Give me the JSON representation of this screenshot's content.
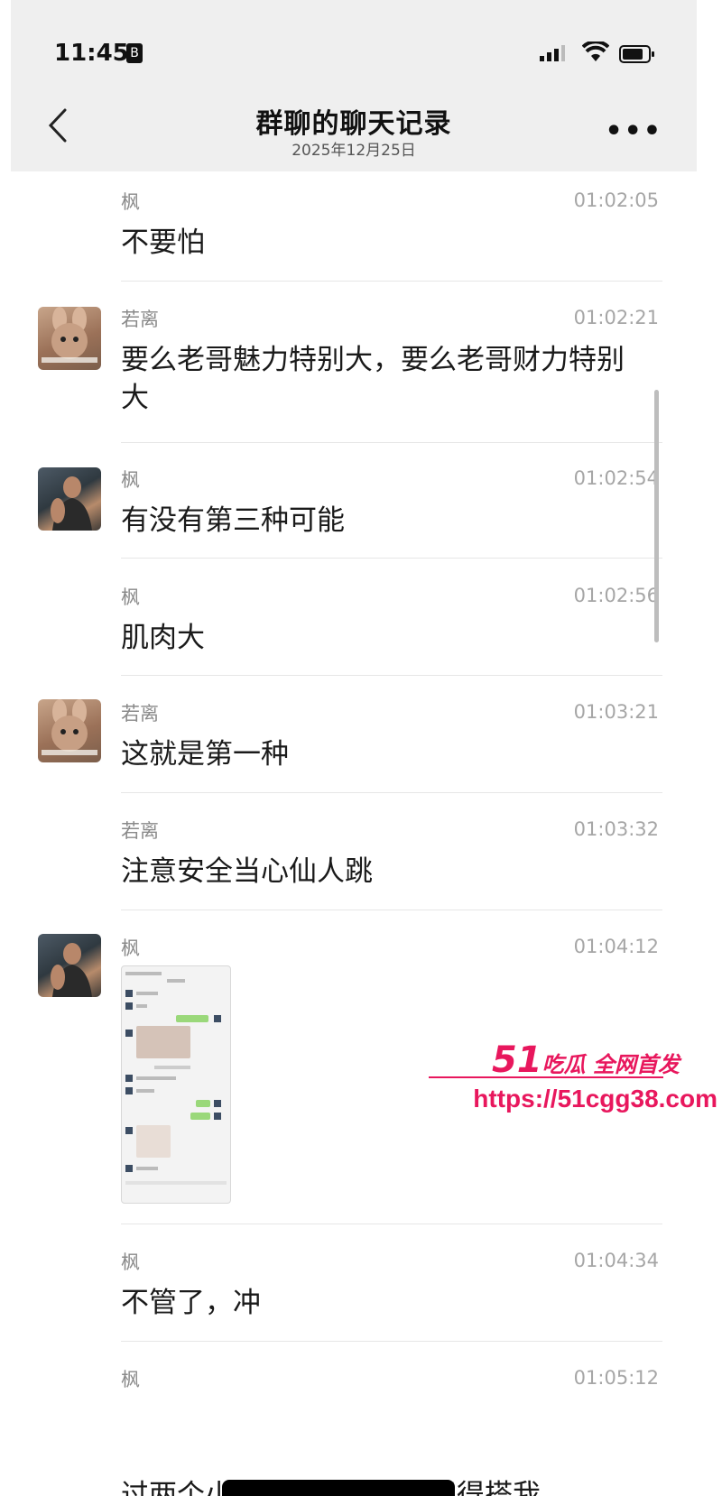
{
  "status_bar": {
    "time": "11:45",
    "badge": "B"
  },
  "header": {
    "title": "群聊的聊天记录",
    "subtitle": "2025年12月25日",
    "more": "•••"
  },
  "messages": [
    {
      "sender": "枫",
      "time": "01:02:05",
      "text": "不要怕"
    },
    {
      "sender": "若离",
      "time": "01:02:21",
      "text": "要么老哥魅力特别大，要么老哥财力特别大"
    },
    {
      "sender": "枫",
      "time": "01:02:54",
      "text": "有没有第三种可能"
    },
    {
      "sender": "枫",
      "time": "01:02:56",
      "text": "肌肉大"
    },
    {
      "sender": "若离",
      "time": "01:03:21",
      "text": "这就是第一种"
    },
    {
      "sender": "若离",
      "time": "01:03:32",
      "text": "注意安全当心仙人跳"
    },
    {
      "sender": "枫",
      "time": "01:04:12",
      "text": ""
    },
    {
      "sender": "枫",
      "time": "01:04:34",
      "text": "不管了，冲"
    },
    {
      "sender": "枫",
      "time": "01:05:12",
      "text": "过两个小时没动静，帮我记得搭我"
    }
  ],
  "watermark": {
    "brand_num": "51",
    "brand_text": "吃瓜 全网首发",
    "url": "https://51cgg38.com"
  },
  "colors": {
    "accent": "#e8175d",
    "background": "#ffffff",
    "header_bg": "#efefef"
  }
}
